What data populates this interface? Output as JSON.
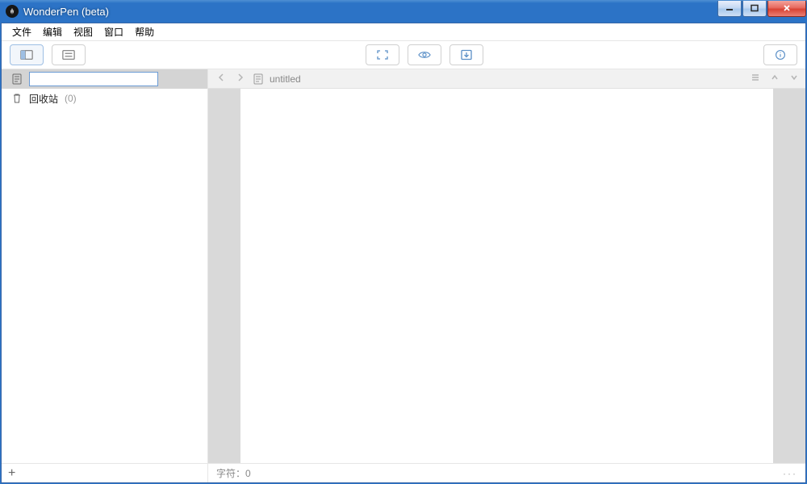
{
  "window": {
    "title": "WonderPen (beta)"
  },
  "menu": {
    "file": "文件",
    "edit": "编辑",
    "view": "视图",
    "window": "窗口",
    "help": "帮助"
  },
  "sidebar": {
    "new_node_value": "",
    "trash_label": "回收站",
    "trash_count": "(0)",
    "add_label": "+"
  },
  "editor": {
    "nav_prev": "‹",
    "nav_next": "›",
    "doc_title": "untitled"
  },
  "status": {
    "char_label": "字符：0",
    "more": "···"
  }
}
